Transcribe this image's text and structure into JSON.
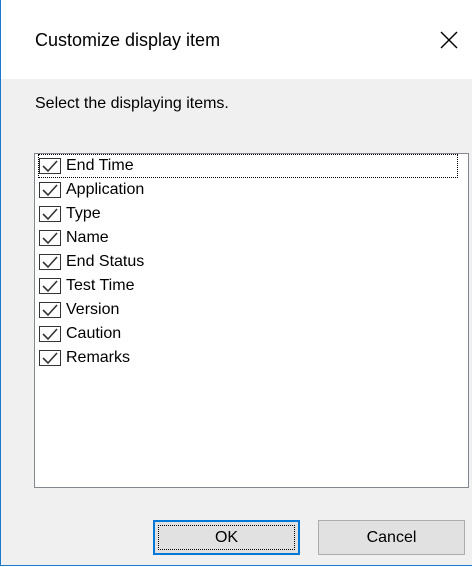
{
  "dialog": {
    "title": "Customize display item",
    "instruction": "Select the displaying items.",
    "items": [
      {
        "label": "End Time",
        "checked": true
      },
      {
        "label": "Application",
        "checked": true
      },
      {
        "label": "Type",
        "checked": true
      },
      {
        "label": "Name",
        "checked": true
      },
      {
        "label": "End Status",
        "checked": true
      },
      {
        "label": "Test Time",
        "checked": true
      },
      {
        "label": "Version",
        "checked": true
      },
      {
        "label": "Caution",
        "checked": true
      },
      {
        "label": "Remarks",
        "checked": true
      }
    ],
    "ok_label": "OK",
    "cancel_label": "Cancel"
  },
  "icons": {
    "close": "close-icon",
    "checkbox": "checkbox-checked-icon"
  },
  "colors": {
    "accent": "#0078d7",
    "window_border": "#1979ca",
    "dialog_background": "#f0f0f0",
    "button_background": "#e1e1e1"
  }
}
